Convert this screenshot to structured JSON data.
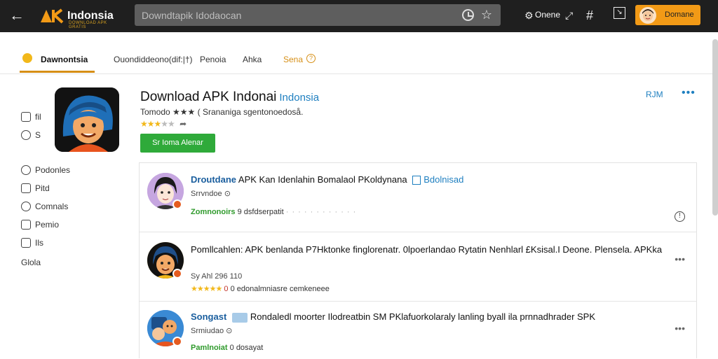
{
  "topbar": {
    "logo_text": "Indonsia",
    "logo_sub": "DOWNLOAD APK GRATIS",
    "search_value": "Downdtapik Idodaocan",
    "online_label": "Onene",
    "account_label": "Domane"
  },
  "tabs": {
    "items": [
      {
        "label": "Dawnontsia"
      },
      {
        "label": "Ouondiddeono(dif:|†)"
      },
      {
        "label": "Penoia"
      },
      {
        "label": "Ahka"
      },
      {
        "label": "Sena"
      }
    ]
  },
  "sidebar": {
    "items": [
      {
        "label": "fil"
      },
      {
        "label": "S"
      },
      {
        "label": "Podonles"
      },
      {
        "label": "Pitd"
      },
      {
        "label": "Comnals"
      },
      {
        "label": "Pemio"
      },
      {
        "label": "Ils"
      },
      {
        "label": "Glola"
      }
    ]
  },
  "app": {
    "title": "Download APK Indonai",
    "title_tag": "Indonsia",
    "meta": "Tomodo ★★★ ( Srananiga sgentonoedoså.",
    "rating_stars": "★★★",
    "rating_off": "★★",
    "rating_score": 3,
    "rating_max": 5,
    "cta_label": "Sr Ioma Alenar",
    "side_link": "RJM"
  },
  "results": [
    {
      "lead": "Droutdane",
      "title": "APK Kan Idenlahin Bomalaol PKoldynana",
      "tag": "Bdolnisad",
      "sub": "Srrvndoe ⊙",
      "foot_green": "Zomnonoirs",
      "foot_text": "9 dsfdserpatit",
      "foot_grey": "· · · · · · · · · · · ·"
    },
    {
      "lead": "",
      "title": "Pomllcahlen: APK benlanda P7Hktonke finglorenatr. 0lpoerlandao Rytatin Nenhlarl £Ksisal.I Deone. Plensela. APKka",
      "tag": "",
      "sub": "Sy Ahl 296 110",
      "foot_green": "★★★★★",
      "foot_text": "0 edonalmniasre cemkeneee",
      "foot_grey": ""
    },
    {
      "lead": "Songast",
      "title": "Rondaledl moorter Ilodreatbin SM PKlafuorkolaraly lanling byall ila prnnadhrader SPK",
      "tag": "",
      "sub": "Srmiudao ⊙",
      "foot_green": "Pamlnoiat",
      "foot_text": "0 dosayat",
      "foot_grey": ""
    }
  ],
  "colors": {
    "topbar": "#1f1f1f",
    "accent": "#f29a16",
    "cta": "#2faa3a",
    "link": "#1e7fc0"
  }
}
